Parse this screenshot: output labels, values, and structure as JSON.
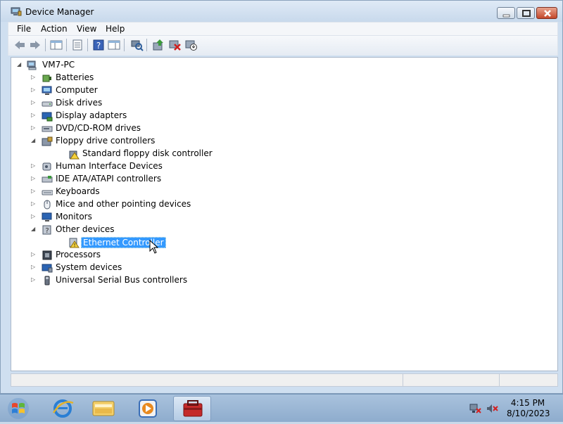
{
  "window": {
    "title": "Device Manager"
  },
  "menu": [
    "File",
    "Action",
    "View",
    "Help"
  ],
  "tree": {
    "root": "VM7-PC",
    "items": [
      {
        "label": "Batteries",
        "icon": "battery-icon"
      },
      {
        "label": "Computer",
        "icon": "computer-icon"
      },
      {
        "label": "Disk drives",
        "icon": "disk-drive-icon"
      },
      {
        "label": "Display adapters",
        "icon": "display-adapter-icon"
      },
      {
        "label": "DVD/CD-ROM drives",
        "icon": "dvd-drive-icon"
      },
      {
        "label": "Floppy drive controllers",
        "icon": "floppy-controller-icon",
        "expanded": true
      },
      {
        "label": "Standard floppy disk controller",
        "icon": "controller-icon",
        "child": true
      },
      {
        "label": "Human Interface Devices",
        "icon": "hid-icon"
      },
      {
        "label": "IDE ATA/ATAPI controllers",
        "icon": "ide-controller-icon"
      },
      {
        "label": "Keyboards",
        "icon": "keyboard-icon"
      },
      {
        "label": "Mice and other pointing devices",
        "icon": "mouse-icon"
      },
      {
        "label": "Monitors",
        "icon": "monitor-icon"
      },
      {
        "label": "Other devices",
        "icon": "unknown-device-icon",
        "expanded": true
      },
      {
        "label": "Ethernet Controller",
        "icon": "warning-device-icon",
        "child": true,
        "selected": true
      },
      {
        "label": "Processors",
        "icon": "processor-icon"
      },
      {
        "label": "System devices",
        "icon": "system-devices-icon"
      },
      {
        "label": "Universal Serial Bus controllers",
        "icon": "usb-icon"
      }
    ]
  },
  "taskbar": {
    "clock_time": "4:15 PM",
    "clock_date": "8/10/2023"
  },
  "colors": {
    "selection": "#3399ff",
    "taskbar": "#9db8d8"
  }
}
